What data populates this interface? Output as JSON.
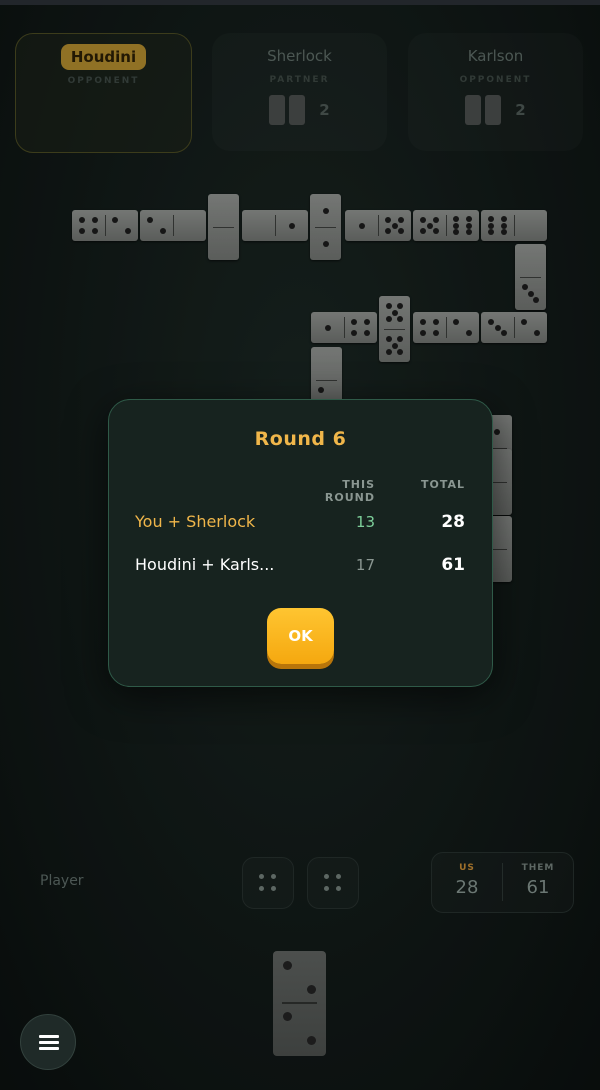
{
  "players": [
    {
      "name": "Houdini",
      "role": "OPPONENT",
      "count": ""
    },
    {
      "name": "Sherlock",
      "role": "PARTNER",
      "count": "2"
    },
    {
      "name": "Karlson",
      "role": "OPPONENT",
      "count": "2"
    }
  ],
  "dialog": {
    "title": "Round 6",
    "col_this_round": "THIS ROUND",
    "col_total": "TOTAL",
    "rows": [
      {
        "team": "You + Sherlock",
        "this_round": "13",
        "total": "28"
      },
      {
        "team": "Houdini + Karls...",
        "this_round": "17",
        "total": "61"
      }
    ],
    "ok_label": "OK"
  },
  "bottom": {
    "player_label": "Player",
    "score": {
      "us_label": "US",
      "us": "28",
      "them_label": "THEM",
      "them": "61"
    }
  },
  "colors": {
    "accent": "#f0b64a",
    "us_green": "#7dcf9a",
    "ok_button": "#ffc531",
    "dialog_border": "#2f5a48"
  },
  "icons": [
    "menu-icon",
    "dice-icon"
  ]
}
